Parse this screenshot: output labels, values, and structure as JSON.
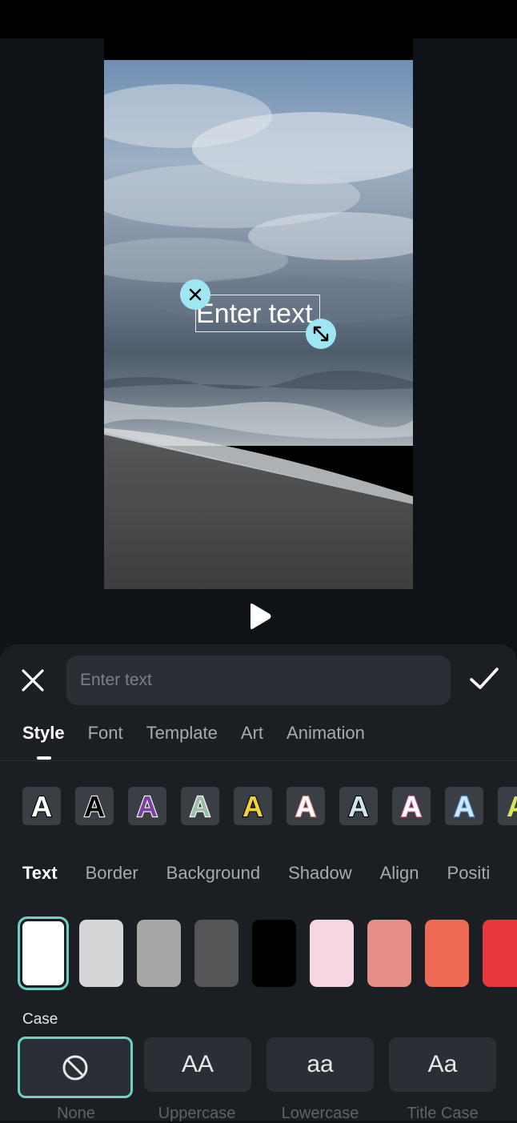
{
  "canvas": {
    "text_overlay": "Enter text",
    "delete_icon": "close-icon",
    "resize_icon": "resize-icon"
  },
  "player": {
    "play_icon": "play-icon"
  },
  "editor": {
    "close_icon": "close-icon",
    "input_placeholder": "Enter text",
    "input_value": "",
    "confirm_icon": "check-icon"
  },
  "tabs": [
    {
      "label": "Style",
      "active": true
    },
    {
      "label": "Font",
      "active": false
    },
    {
      "label": "Template",
      "active": false
    },
    {
      "label": "Art",
      "active": false
    },
    {
      "label": "Animation",
      "active": false
    }
  ],
  "style_presets": [
    {
      "letter": "A",
      "fill": "#ffffff",
      "stroke": "#000000"
    },
    {
      "letter": "A",
      "fill": "#000000",
      "stroke": "#ffffff"
    },
    {
      "letter": "A",
      "fill": "#7b3fa8",
      "stroke": "#ffffff"
    },
    {
      "letter": "A",
      "fill": "#9cbfa8",
      "stroke": "#ffffff"
    },
    {
      "letter": "A",
      "fill": "#f2d13b",
      "stroke": "#000000"
    },
    {
      "letter": "A",
      "fill": "#ffffff",
      "stroke": "#d9787a"
    },
    {
      "letter": "A",
      "fill": "#cfe6f2",
      "stroke": "#000000"
    },
    {
      "letter": "A",
      "fill": "#ffffff",
      "stroke": "#e46aa0"
    },
    {
      "letter": "A",
      "fill": "#cfe8f7",
      "stroke": "#4a8fe0"
    },
    {
      "letter": "A",
      "fill": "#d9e85a",
      "stroke": "#3a3f46"
    }
  ],
  "subtabs": [
    {
      "label": "Text",
      "active": true
    },
    {
      "label": "Border",
      "active": false
    },
    {
      "label": "Background",
      "active": false
    },
    {
      "label": "Shadow",
      "active": false
    },
    {
      "label": "Align",
      "active": false
    },
    {
      "label": "Positi",
      "active": false
    }
  ],
  "color_swatches": [
    {
      "color": "#ffffff",
      "selected": true
    },
    {
      "color": "#d6d6d6",
      "selected": false
    },
    {
      "color": "#a6a6a6",
      "selected": false
    },
    {
      "color": "#555555",
      "selected": false
    },
    {
      "color": "#000000",
      "selected": false
    },
    {
      "color": "#f7d6e4",
      "selected": false
    },
    {
      "color": "#e78e8a",
      "selected": false
    },
    {
      "color": "#ee6a55",
      "selected": false
    },
    {
      "color": "#e8383d",
      "selected": false
    }
  ],
  "case": {
    "label": "Case",
    "options": [
      {
        "glyph": "",
        "caption": "None",
        "icon": "no-icon",
        "selected": true
      },
      {
        "glyph": "AA",
        "caption": "Uppercase",
        "selected": false
      },
      {
        "glyph": "aa",
        "caption": "Lowercase",
        "selected": false
      },
      {
        "glyph": "Aa",
        "caption": "Title Case",
        "selected": false
      }
    ]
  },
  "colors": {
    "accent": "#6fd1c4",
    "handle": "#9ee6f1",
    "panel": "#1b1f24"
  }
}
